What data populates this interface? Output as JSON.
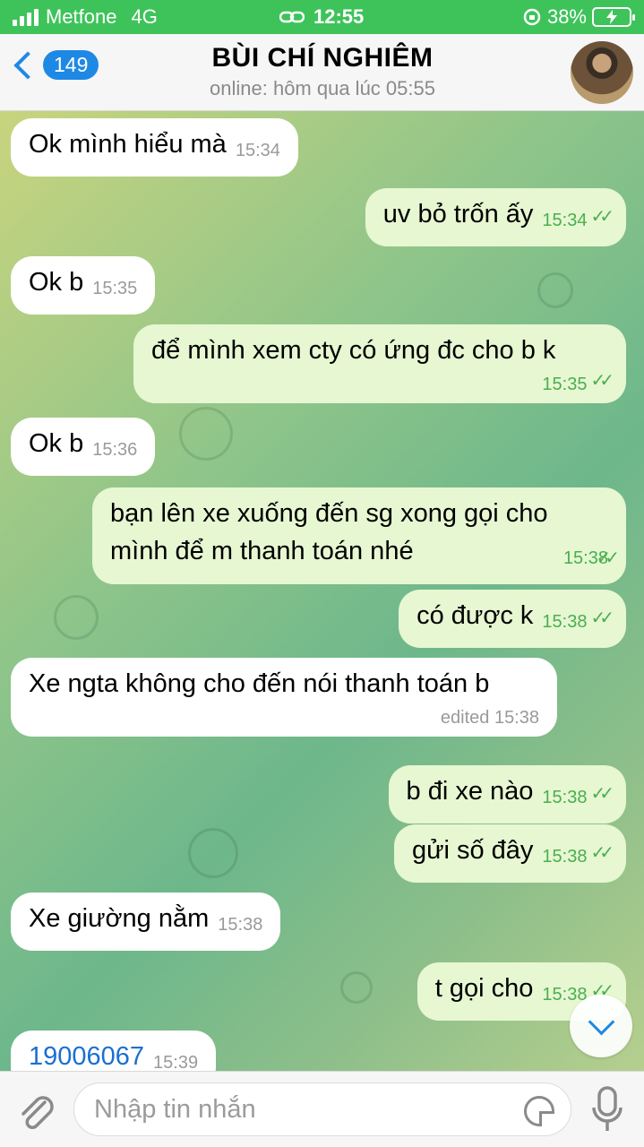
{
  "status_bar": {
    "carrier": "Metfone",
    "network": "4G",
    "time": "12:55",
    "battery": "38%"
  },
  "header": {
    "back_count": "149",
    "title": "BÙI CHÍ NGHIÊM",
    "subtitle": "online: hôm qua lúc 05:55"
  },
  "messages": [
    {
      "dir": "in",
      "text": "Ok mình hiểu mà",
      "time": "15:34"
    },
    {
      "dir": "out",
      "text": "uv bỏ trốn ấy",
      "time": "15:34"
    },
    {
      "dir": "in",
      "text": "Ok b",
      "time": "15:35"
    },
    {
      "dir": "out",
      "text": "để mình xem cty có ứng đc cho b k",
      "time": "15:35"
    },
    {
      "dir": "in",
      "text": "Ok b",
      "time": "15:36"
    },
    {
      "dir": "out",
      "text": "bạn lên xe xuống đến sg xong gọi cho mình để m thanh toán nhé",
      "time": "15:38"
    },
    {
      "dir": "out",
      "text": "có được k",
      "time": "15:38"
    },
    {
      "dir": "in",
      "text": "Xe ngta không cho đến nói thanh toán b",
      "time": "edited 15:38"
    },
    {
      "dir": "out",
      "text": "b đi xe nào",
      "time": "15:38"
    },
    {
      "dir": "out",
      "text": "gửi số đây",
      "time": "15:38"
    },
    {
      "dir": "in",
      "text": "Xe giường nằm",
      "time": "15:38"
    },
    {
      "dir": "out",
      "text": "t gọi cho",
      "time": "15:38"
    },
    {
      "dir": "in",
      "text": "19006067",
      "time": "15:39"
    }
  ],
  "input": {
    "placeholder": "Nhập tin nhắn"
  },
  "icons": {
    "back": "chevron-left-icon",
    "attach": "paperclip-icon",
    "sticker": "sticker-icon",
    "mic": "microphone-icon",
    "scroll": "chevron-down-icon",
    "read": "double-check-icon"
  },
  "colors": {
    "status_bar": "#3ec35a",
    "accent": "#1e88e5",
    "outgoing_bubble": "#e6f7d2",
    "incoming_bubble": "#ffffff",
    "read_ticks": "#4bae4f"
  }
}
